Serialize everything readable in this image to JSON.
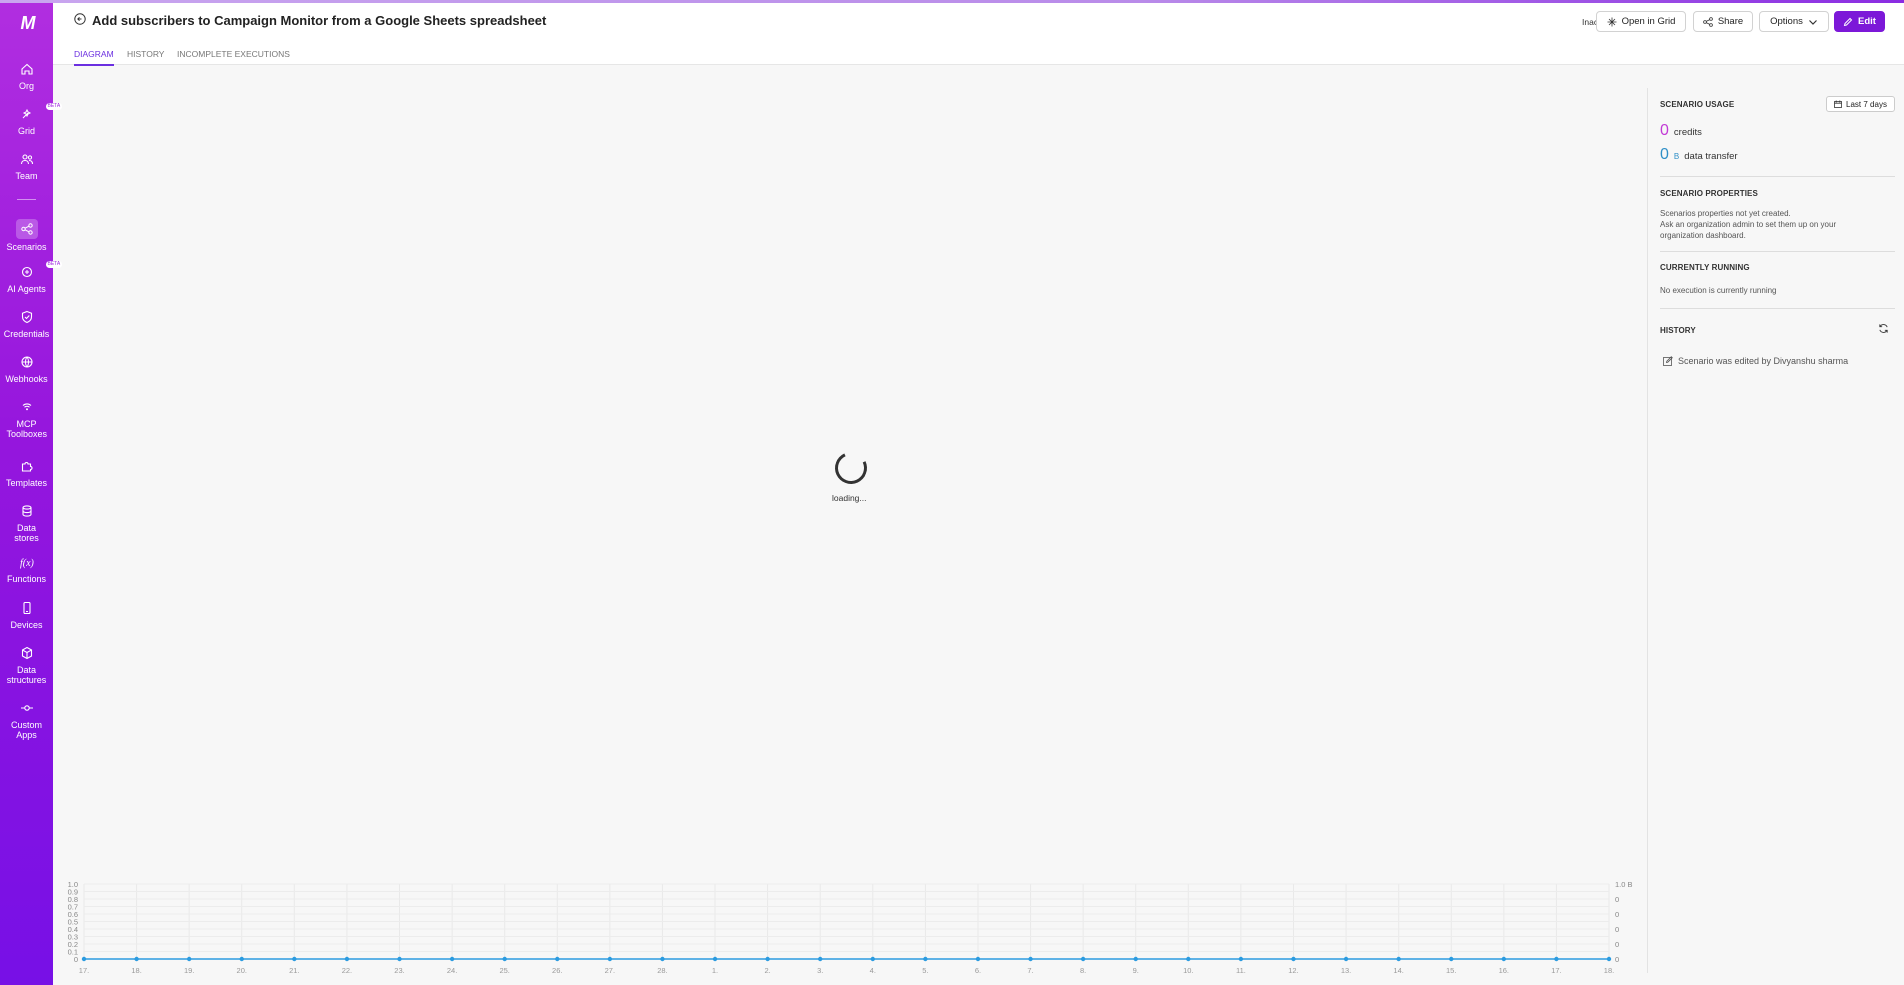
{
  "sidebar": {
    "logo": "M",
    "items": [
      {
        "label": "Org",
        "icon": "home-icon"
      },
      {
        "label": "Grid",
        "icon": "grid-icon",
        "badge": "BETA"
      },
      {
        "label": "Team",
        "icon": "team-icon"
      },
      {
        "label": "Scenarios",
        "icon": "scenarios-icon",
        "active": true
      },
      {
        "label": "AI Agents",
        "icon": "ai-agents-icon",
        "badge": "BETA"
      },
      {
        "label": "Credentials",
        "icon": "shield-icon"
      },
      {
        "label": "Webhooks",
        "icon": "globe-icon"
      },
      {
        "label": "MCP Toolboxes",
        "icon": "mcp-icon"
      },
      {
        "label": "Templates",
        "icon": "puzzle-icon"
      },
      {
        "label": "Data stores",
        "icon": "database-icon"
      },
      {
        "label": "Functions",
        "icon": "function-icon"
      },
      {
        "label": "Devices",
        "icon": "device-icon"
      },
      {
        "label": "Data structures",
        "icon": "cube-icon"
      },
      {
        "label": "Custom Apps",
        "icon": "custom-apps-icon"
      }
    ]
  },
  "header": {
    "title": "Add subscribers to Campaign Monitor from a Google Sheets spreadsheet",
    "tabs": [
      "DIAGRAM",
      "HISTORY",
      "INCOMPLETE EXECUTIONS"
    ],
    "active_tab": "DIAGRAM",
    "status_label": "Inactive",
    "buttons": {
      "open_grid": "Open in Grid",
      "share": "Share",
      "options": "Options",
      "edit": "Edit"
    }
  },
  "canvas": {
    "loading_text": "loading..."
  },
  "panel": {
    "usage_title": "SCENARIO USAGE",
    "period": "Last 7 days",
    "credits_value": "0",
    "credits_label": "credits",
    "transfer_value": "0",
    "transfer_unit": "B",
    "transfer_label": "data transfer",
    "properties_title": "SCENARIO PROPERTIES",
    "properties_line1": "Scenarios properties not yet created.",
    "properties_line2": "Ask an organization admin to set them up on your organization dashboard.",
    "running_title": "CURRENTLY RUNNING",
    "running_text": "No execution is currently running",
    "history_title": "HISTORY",
    "history_entry": "Scenario was edited by Divyanshu sharma"
  },
  "colors": {
    "accent": "#7c18d8",
    "credits": "#c23ad6",
    "transfer": "#2f8fc7",
    "chart_line": "#2b9be0"
  },
  "chart_data": {
    "type": "line",
    "x": [
      "17.",
      "18.",
      "19.",
      "20.",
      "21.",
      "22.",
      "23.",
      "24.",
      "25.",
      "26.",
      "27.",
      "28.",
      "1.",
      "2.",
      "3.",
      "4.",
      "5.",
      "6.",
      "7.",
      "8.",
      "9.",
      "10.",
      "11.",
      "12.",
      "13.",
      "14.",
      "15.",
      "16.",
      "17.",
      "18."
    ],
    "y_left_ticks": [
      "1.0",
      "0.9",
      "0.8",
      "0.7",
      "0.6",
      "0.5",
      "0.4",
      "0.3",
      "0.2",
      "0.1",
      "0"
    ],
    "y_right_ticks": [
      "1.0 B",
      "0",
      "0",
      "0",
      "0",
      "0"
    ],
    "ylim": [
      0,
      1
    ],
    "series": [
      {
        "values": [
          0,
          0,
          0,
          0,
          0,
          0,
          0,
          0,
          0,
          0,
          0,
          0,
          0,
          0,
          0,
          0,
          0,
          0,
          0,
          0,
          0,
          0,
          0,
          0,
          0,
          0,
          0,
          0,
          0,
          0
        ]
      }
    ],
    "grid": true
  }
}
